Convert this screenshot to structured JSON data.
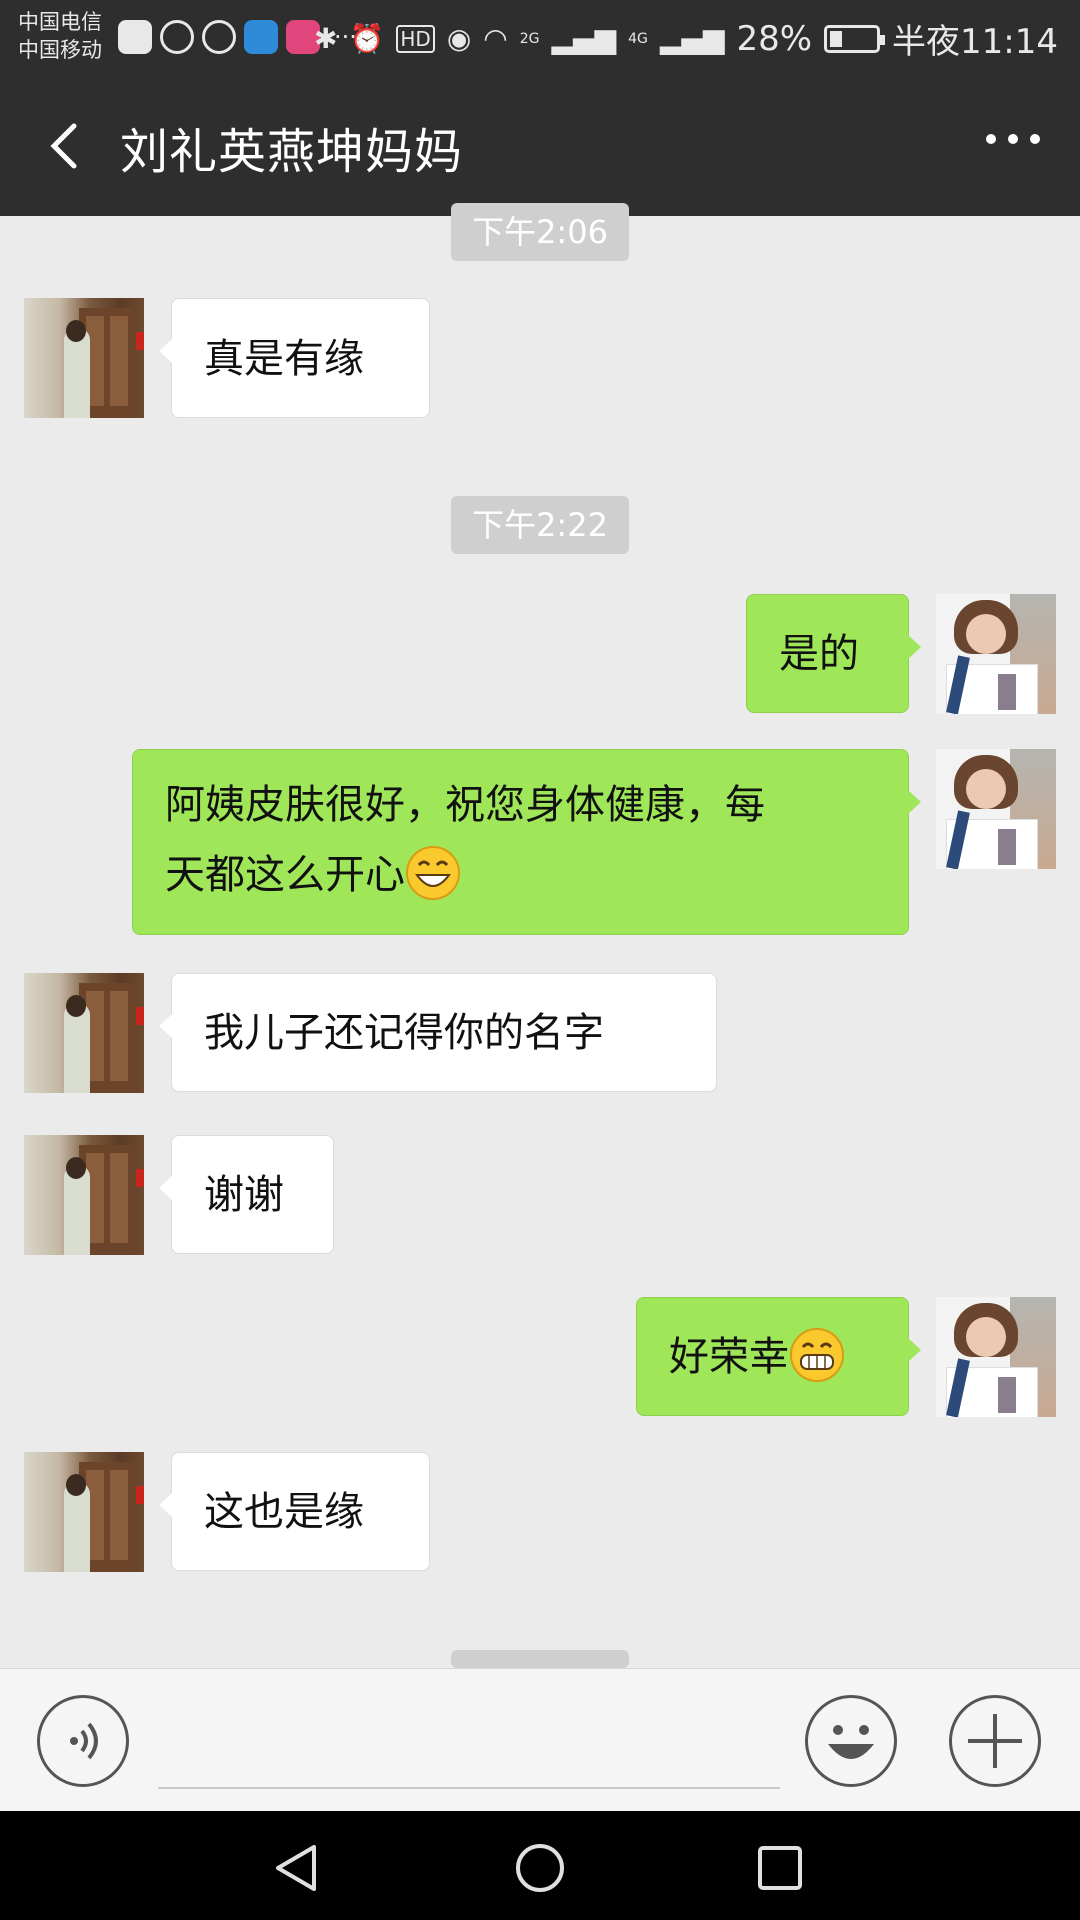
{
  "status_bar": {
    "carrier_1": "中国电信",
    "carrier_2": "中国移动",
    "more": "···",
    "signal_2g": "2G",
    "signal_4g": "4G",
    "hd": "HD",
    "battery_percent": "28%",
    "battery_level": 0.28,
    "time": "半夜11:14"
  },
  "header": {
    "back_icon": "chevron-left-icon",
    "title": "刘礼英燕坤妈妈",
    "more_icon": "more-dots-icon"
  },
  "messages": [
    {
      "type": "time",
      "text": "下午2:06"
    },
    {
      "type": "received",
      "text": "真是有缘"
    },
    {
      "type": "time",
      "text": "下午2:22"
    },
    {
      "type": "sent",
      "text": "是的"
    },
    {
      "type": "sent",
      "line1": "阿姨皮肤很好，祝您身体健康，每",
      "line2": "天都这么开心",
      "emoji": "grin-emoji"
    },
    {
      "type": "received",
      "text": "我儿子还记得你的名字"
    },
    {
      "type": "received",
      "text": "谢谢"
    },
    {
      "type": "sent",
      "text": "好荣幸",
      "emoji": "toothy-grin-emoji"
    },
    {
      "type": "received",
      "text": "这也是缘"
    }
  ],
  "input_bar": {
    "voice_icon": "voice-icon",
    "input_value": "",
    "emoji_icon": "smiley-icon",
    "plus_icon": "plus-icon"
  },
  "nav_bar": {
    "back": "triangle-back-icon",
    "home": "circle-home-icon",
    "recents": "square-recents-icon"
  },
  "colors": {
    "header_bg": "#2e2e2e",
    "chat_bg": "#ebebeb",
    "sent_bubble": "#9fe659",
    "received_bubble": "#ffffff",
    "time_chip": "#cfcfcf"
  }
}
